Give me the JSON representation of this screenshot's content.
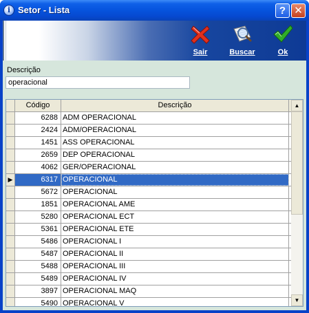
{
  "window": {
    "title": "Setor - Lista",
    "help_label": "?",
    "close_label": "✕"
  },
  "toolbar": {
    "sair": "Sair",
    "buscar": "Buscar",
    "ok": "Ok"
  },
  "search": {
    "label": "Descrição",
    "value": "operacional"
  },
  "grid": {
    "columns": [
      "Código",
      "Descrição"
    ],
    "selected_index": 5,
    "rows": [
      {
        "codigo": "6288",
        "descricao": "ADM OPERACIONAL"
      },
      {
        "codigo": "2424",
        "descricao": "ADM/OPERACIONAL"
      },
      {
        "codigo": "1451",
        "descricao": "ASS OPERACIONAL"
      },
      {
        "codigo": "2659",
        "descricao": "DEP OPERACIONAL"
      },
      {
        "codigo": "4062",
        "descricao": "GER/OPERACIONAL"
      },
      {
        "codigo": "6317",
        "descricao": "OPERACIONAL"
      },
      {
        "codigo": "5672",
        "descricao": "OPERACIONAL"
      },
      {
        "codigo": "1851",
        "descricao": "OPERACIONAL AME"
      },
      {
        "codigo": "5280",
        "descricao": "OPERACIONAL ECT"
      },
      {
        "codigo": "5361",
        "descricao": "OPERACIONAL ETE"
      },
      {
        "codigo": "5486",
        "descricao": "OPERACIONAL I"
      },
      {
        "codigo": "5487",
        "descricao": "OPERACIONAL II"
      },
      {
        "codigo": "5488",
        "descricao": "OPERACIONAL III"
      },
      {
        "codigo": "5489",
        "descricao": "OPERACIONAL IV"
      },
      {
        "codigo": "3897",
        "descricao": "OPERACIONAL MAQ"
      },
      {
        "codigo": "5490",
        "descricao": "OPERACIONAL V"
      }
    ]
  },
  "icons": {
    "title": "info-icon",
    "sair": "red-x-icon",
    "buscar": "magnifier-icon",
    "ok": "green-check-icon"
  },
  "colors": {
    "titlebar": "#0653dd",
    "selection": "#316ac5",
    "client": "#d6e6dc"
  }
}
